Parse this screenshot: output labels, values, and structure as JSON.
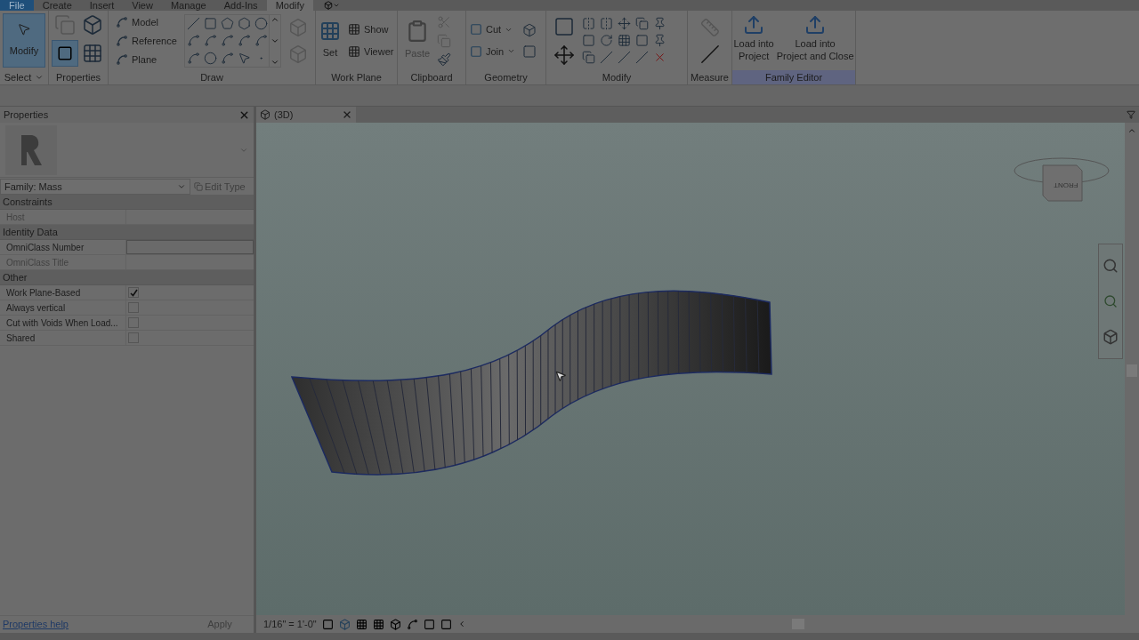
{
  "menu_tabs": [
    {
      "label": "File",
      "kind": "file",
      "selected": false
    },
    {
      "label": "Create",
      "kind": "tab",
      "selected": false
    },
    {
      "label": "Insert",
      "kind": "tab",
      "selected": false
    },
    {
      "label": "View",
      "kind": "tab",
      "selected": false
    },
    {
      "label": "Manage",
      "kind": "tab",
      "selected": false
    },
    {
      "label": "Add-Ins",
      "kind": "tab",
      "selected": false
    },
    {
      "label": "Modify",
      "kind": "tab",
      "selected": true
    }
  ],
  "ribbon": {
    "select": {
      "button": "Modify",
      "selected": true,
      "label": "Select"
    },
    "properties": {
      "label": "Properties"
    },
    "draw": {
      "items": [
        "Model",
        "Reference",
        "Plane"
      ],
      "label": "Draw"
    },
    "work_plane": {
      "set": "Set",
      "items": [
        "Show",
        "Viewer"
      ],
      "label": "Work Plane"
    },
    "clipboard": {
      "paste": "Paste",
      "disabled": true,
      "label": "Clipboard"
    },
    "geometry": {
      "items": [
        "Cut",
        "Join"
      ],
      "label": "Geometry"
    },
    "modify": {
      "label": "Modify"
    },
    "measure": {
      "label": "Measure"
    },
    "family_editor": {
      "buttons": [
        "Load into\nProject",
        "Load into\nProject and Close"
      ],
      "label": "Family Editor",
      "highlighted": true
    }
  },
  "properties_panel": {
    "title": "Properties",
    "type_selector": "Family: Mass",
    "edit_type": {
      "label": "Edit Type",
      "disabled": true
    },
    "sections": [
      {
        "name": "Constraints",
        "rows": [
          {
            "kind": "text",
            "label": "Host",
            "disabled": true
          }
        ]
      },
      {
        "name": "Identity Data",
        "rows": [
          {
            "kind": "text",
            "label": "OmniClass Number",
            "disabled": false
          },
          {
            "kind": "text",
            "label": "OmniClass Title",
            "disabled": true
          }
        ]
      },
      {
        "name": "Other",
        "rows": [
          {
            "kind": "checkbox",
            "label": "Work Plane-Based",
            "checked": true
          },
          {
            "kind": "checkbox",
            "label": "Always vertical",
            "checked": false
          },
          {
            "kind": "checkbox",
            "label": "Cut with Voids When Load...",
            "checked": false
          },
          {
            "kind": "checkbox",
            "label": "Shared",
            "checked": false
          }
        ]
      }
    ],
    "help_link": "Properties help",
    "apply": {
      "label": "Apply",
      "disabled": true
    }
  },
  "view": {
    "tab": {
      "title": "(3D)"
    },
    "view_cube": {
      "face": "FRONT"
    },
    "scale": "1/16\" = 1'-0\""
  }
}
